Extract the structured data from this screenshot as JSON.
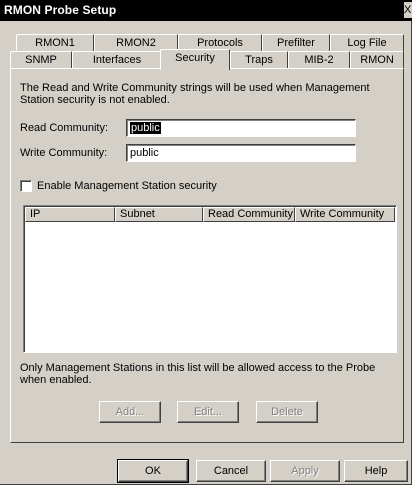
{
  "window": {
    "title": "RMON Probe Setup",
    "close_glyph": "X"
  },
  "tabs": {
    "row1": [
      "RMON1",
      "RMON2",
      "Protocols",
      "Prefilter",
      "Log File"
    ],
    "row2": [
      "SNMP",
      "Interfaces",
      "Security",
      "Traps",
      "MIB-2",
      "RMON"
    ],
    "active": "Security"
  },
  "security": {
    "intro": "The Read and Write Community strings will be used when Management Station security is not enabled.",
    "read_label": "Read Community:",
    "read_value": "public",
    "write_label": "Write Community:",
    "write_value": "public",
    "checkbox_label": "Enable Management Station security",
    "checkbox_checked": false,
    "columns": [
      "IP",
      "Subnet",
      "Read Community",
      "Write Community"
    ],
    "rows": [],
    "note": "Only Management Stations in this list will be allowed access to the Probe when enabled.",
    "add_label": "Add...",
    "edit_label": "Edit...",
    "delete_label": "Delete"
  },
  "footer": {
    "ok_label": "OK",
    "cancel_label": "Cancel",
    "apply_label": "Apply",
    "help_label": "Help"
  }
}
